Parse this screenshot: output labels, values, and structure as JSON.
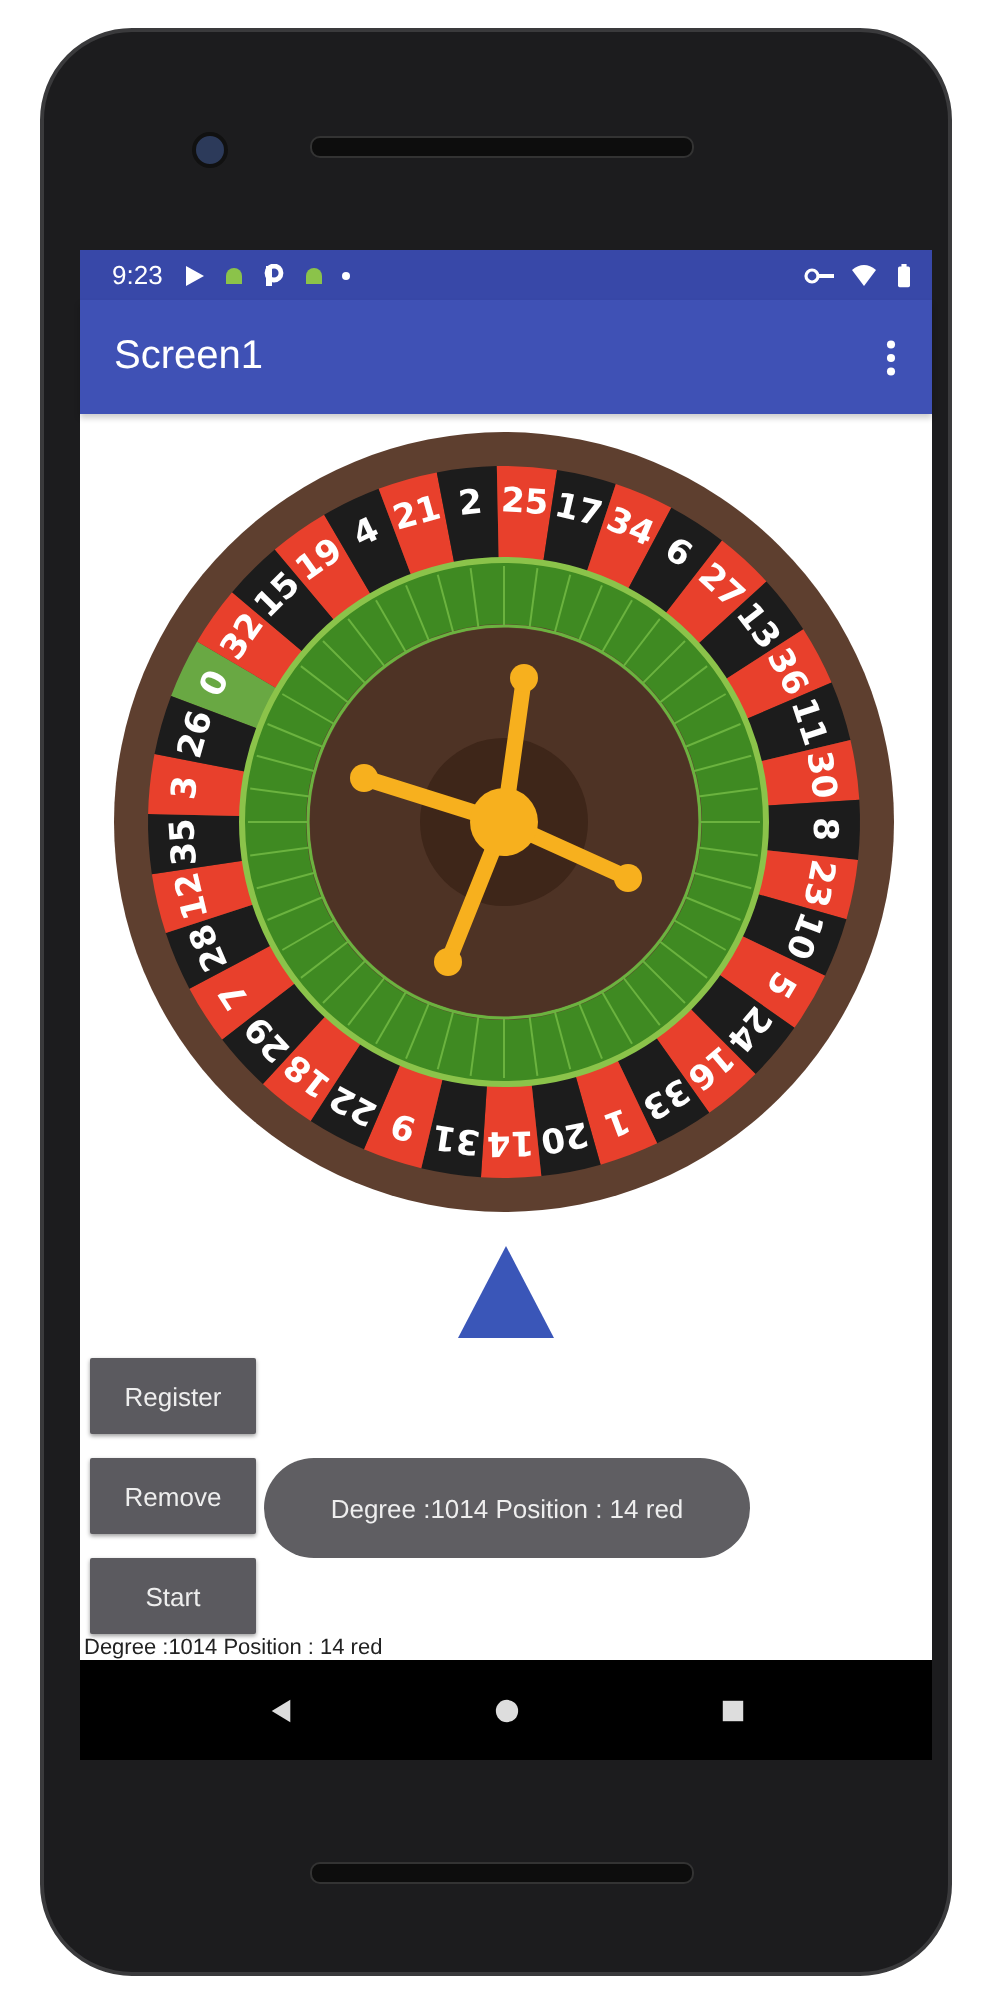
{
  "status_bar": {
    "time": "9:23"
  },
  "app_bar": {
    "title": "Screen1"
  },
  "wheel": {
    "pockets": [
      {
        "number": "0",
        "color": "#69a843"
      },
      {
        "number": "32",
        "color": "#e8402c"
      },
      {
        "number": "15",
        "color": "#1c1c1c"
      },
      {
        "number": "19",
        "color": "#e8402c"
      },
      {
        "number": "4",
        "color": "#1c1c1c"
      },
      {
        "number": "21",
        "color": "#e8402c"
      },
      {
        "number": "2",
        "color": "#1c1c1c"
      },
      {
        "number": "25",
        "color": "#e8402c"
      },
      {
        "number": "17",
        "color": "#1c1c1c"
      },
      {
        "number": "34",
        "color": "#e8402c"
      },
      {
        "number": "6",
        "color": "#1c1c1c"
      },
      {
        "number": "27",
        "color": "#e8402c"
      },
      {
        "number": "13",
        "color": "#1c1c1c"
      },
      {
        "number": "36",
        "color": "#e8402c"
      },
      {
        "number": "11",
        "color": "#1c1c1c"
      },
      {
        "number": "30",
        "color": "#e8402c"
      },
      {
        "number": "8",
        "color": "#1c1c1c"
      },
      {
        "number": "23",
        "color": "#e8402c"
      },
      {
        "number": "10",
        "color": "#1c1c1c"
      },
      {
        "number": "5",
        "color": "#e8402c"
      },
      {
        "number": "24",
        "color": "#1c1c1c"
      },
      {
        "number": "16",
        "color": "#e8402c"
      },
      {
        "number": "33",
        "color": "#1c1c1c"
      },
      {
        "number": "1",
        "color": "#e8402c"
      },
      {
        "number": "20",
        "color": "#1c1c1c"
      },
      {
        "number": "14",
        "color": "#e8402c"
      },
      {
        "number": "31",
        "color": "#1c1c1c"
      },
      {
        "number": "9",
        "color": "#e8402c"
      },
      {
        "number": "22",
        "color": "#1c1c1c"
      },
      {
        "number": "18",
        "color": "#e8402c"
      },
      {
        "number": "29",
        "color": "#1c1c1c"
      },
      {
        "number": "7",
        "color": "#e8402c"
      },
      {
        "number": "28",
        "color": "#1c1c1c"
      },
      {
        "number": "12",
        "color": "#e8402c"
      },
      {
        "number": "35",
        "color": "#1c1c1c"
      },
      {
        "number": "3",
        "color": "#e8402c"
      },
      {
        "number": "26",
        "color": "#1c1c1c"
      }
    ]
  },
  "buttons": [
    "Register",
    "Remove",
    "Start"
  ],
  "toast": {
    "text": "Degree :1014 Position : 14 red"
  },
  "result_label": {
    "text": "Degree :1014 Position : 14 red"
  }
}
